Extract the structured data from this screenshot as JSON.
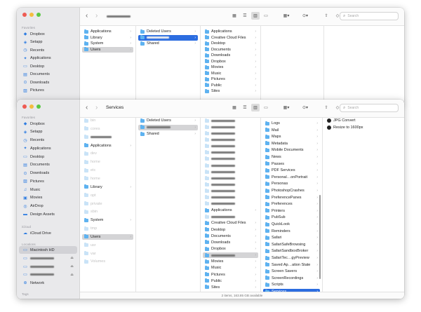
{
  "window1": {
    "sidebar": {
      "favorites_header": "Favorites",
      "items": [
        {
          "label": "Dropbox",
          "icon": "dropbox-icon",
          "glyph": "◆"
        },
        {
          "label": "Setapp",
          "icon": "setapp-icon",
          "glyph": "◈"
        },
        {
          "label": "Recents",
          "icon": "clock-icon",
          "glyph": "◷"
        },
        {
          "label": "Applications",
          "icon": "applications-icon",
          "glyph": "✦"
        },
        {
          "label": "Desktop",
          "icon": "desktop-icon",
          "glyph": "▭"
        },
        {
          "label": "Documents",
          "icon": "document-icon",
          "glyph": "▤"
        },
        {
          "label": "Downloads",
          "icon": "download-icon",
          "glyph": "⊙"
        },
        {
          "label": "Pictures",
          "icon": "pictures-icon",
          "glyph": "▨"
        }
      ]
    },
    "toolbar": {
      "search_placeholder": "Search"
    },
    "col1": [
      {
        "label": "Applications"
      },
      {
        "label": "Library"
      },
      {
        "label": "System"
      },
      {
        "label": "Users",
        "gsel": true
      }
    ],
    "col2": [
      {
        "label": "Deleted Users"
      },
      {
        "label": "",
        "sel": true
      },
      {
        "label": "Shared"
      }
    ],
    "col3": [
      "Applications",
      "Creative Cloud Files",
      "Desktop",
      "Documents",
      "Downloads",
      "Dropbox",
      "Movies",
      "Music",
      "Pictures",
      "Public",
      "Sites"
    ]
  },
  "window2": {
    "title": "Services",
    "sidebar": {
      "favorites_header": "Favorites",
      "favorites": [
        {
          "label": "Dropbox",
          "icon": "dropbox-icon",
          "glyph": "◆"
        },
        {
          "label": "Setapp",
          "icon": "setapp-icon",
          "glyph": "◈"
        },
        {
          "label": "Recents",
          "icon": "clock-icon",
          "glyph": "◷"
        },
        {
          "label": "Applications",
          "icon": "applications-icon",
          "glyph": "✦"
        },
        {
          "label": "Desktop",
          "icon": "desktop-icon",
          "glyph": "▭"
        },
        {
          "label": "Documents",
          "icon": "document-icon",
          "glyph": "▤"
        },
        {
          "label": "Downloads",
          "icon": "download-icon",
          "glyph": "⊙"
        },
        {
          "label": "Pictures",
          "icon": "pictures-icon",
          "glyph": "▨"
        },
        {
          "label": "Music",
          "icon": "music-icon",
          "glyph": "♫"
        },
        {
          "label": "Movies",
          "icon": "movies-icon",
          "glyph": "▣"
        },
        {
          "label": "AirDrop",
          "icon": "airdrop-icon",
          "glyph": "◎"
        },
        {
          "label": "Design Assets",
          "icon": "folder-icon",
          "glyph": "▬"
        }
      ],
      "cloud_header": "iCloud",
      "cloud": [
        {
          "label": "iCloud Drive",
          "icon": "cloud-icon",
          "glyph": "☁"
        }
      ],
      "locations_header": "Locations",
      "locations": [
        {
          "label": "Macintosh HD",
          "icon": "disk-icon",
          "glyph": "▭",
          "sel": true
        },
        {
          "label": "",
          "icon": "disk-icon",
          "glyph": "▭",
          "eject": true
        },
        {
          "label": "",
          "icon": "disk-icon",
          "glyph": "▭",
          "eject": true
        },
        {
          "label": "",
          "icon": "disk-icon",
          "glyph": "▭",
          "eject": true
        },
        {
          "label": "Network",
          "icon": "network-icon",
          "glyph": "⊕"
        }
      ],
      "tags_header": "Tags"
    },
    "toolbar": {
      "search_placeholder": "Search"
    },
    "col1": [
      {
        "label": "bin",
        "dim": true
      },
      {
        "label": "cores",
        "dim": true
      },
      {
        "label": "",
        "dim": true
      },
      {
        "label": "Applications"
      },
      {
        "label": "dev",
        "dim": true
      },
      {
        "label": "home",
        "dim": true
      },
      {
        "label": "etc",
        "dim": true
      },
      {
        "label": "home",
        "dim": true
      },
      {
        "label": "Library"
      },
      {
        "label": "opt",
        "dim": true
      },
      {
        "label": "private",
        "dim": true
      },
      {
        "label": "sbin",
        "dim": true
      },
      {
        "label": "System"
      },
      {
        "label": "tmp",
        "dim": true
      },
      {
        "label": "Users",
        "gsel": true
      },
      {
        "label": "usr",
        "dim": true
      },
      {
        "label": "var",
        "dim": true
      },
      {
        "label": "Volumes",
        "dim": true
      }
    ],
    "col2": [
      {
        "label": "Deleted Users"
      },
      {
        "label": "",
        "gsel": true
      },
      {
        "label": "Shared"
      }
    ],
    "col3": [
      {
        "label": "",
        "dim": true
      },
      {
        "label": "",
        "dim": true
      },
      {
        "label": "",
        "dim": true
      },
      {
        "label": "",
        "dim": true
      },
      {
        "label": "",
        "dim": true
      },
      {
        "label": "",
        "dim": true
      },
      {
        "label": "",
        "dim": true
      },
      {
        "label": "",
        "dim": true
      },
      {
        "label": "",
        "dim": true
      },
      {
        "label": "",
        "dim": true
      },
      {
        "label": "",
        "dim": true
      },
      {
        "label": "",
        "dim": true
      },
      {
        "label": "",
        "dim": true
      },
      {
        "label": "",
        "dim": true
      },
      {
        "label": "Applications"
      },
      {
        "label": "",
        "dim": true
      },
      {
        "label": "Creative Cloud Files"
      },
      {
        "label": "Desktop"
      },
      {
        "label": "Documents"
      },
      {
        "label": "Downloads"
      },
      {
        "label": "Dropbox"
      },
      {
        "label": "",
        "gsel": true
      },
      {
        "label": "Movies"
      },
      {
        "label": "Music"
      },
      {
        "label": "Pictures"
      },
      {
        "label": "Public"
      },
      {
        "label": "Sites"
      }
    ],
    "col4": [
      "Logs",
      "Mail",
      "Maps",
      "Metadata",
      "Mobile Documents",
      "News",
      "Passes",
      "PDF Services",
      "Personal…onPortrait",
      "Personas",
      "PhotoshopCrashes",
      "PreferencePanes",
      "Preferences",
      "Printers",
      "PubSub",
      "QuickLook",
      "Reminders",
      "Safari",
      "SafariSafeBrowsing",
      "SafariSandboxBroker",
      "SafariTec…gyPreview",
      "Saved Ap…ation State",
      "Screen Savers",
      "ScreenRecordings",
      "Scripts",
      "Services"
    ],
    "col4_selected": "Services",
    "col5": [
      {
        "label": "JPG Convert",
        "icon": "workflow-icon"
      },
      {
        "label": "Resize to 1600px",
        "icon": "workflow-icon"
      }
    ],
    "status": "2 items, 163.85 GB available"
  }
}
